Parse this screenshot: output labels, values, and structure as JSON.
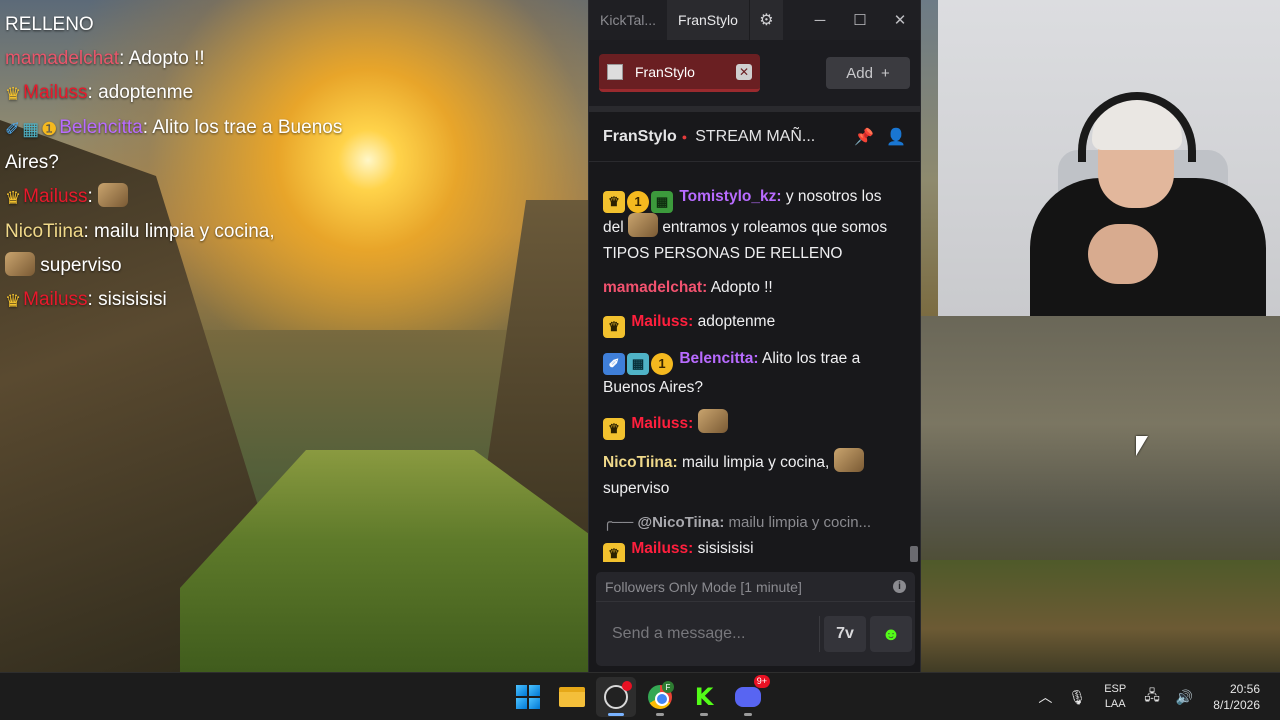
{
  "overlay_chat": {
    "l0": "RELLENO",
    "l1_user": "mamadelchat",
    "l1_text": ": Adopto !!",
    "l2_user": "Mailuss",
    "l2_text": ": adoptenme",
    "l3_user": "Belencitta",
    "l3_text": ": Alito los trae a Buenos Aires?",
    "l4_user": "Mailuss",
    "l4_text": ":",
    "l5_user": "NicoTiina",
    "l5_text": ": mailu limpia y cocina,",
    "l5_text2": "superviso",
    "l6_user": "Mailuss",
    "l6_text": ": sisisisisi",
    "colors": {
      "mamadelchat": "#e8566b",
      "mailuss": "#e8192c",
      "belencitta": "#b86bff",
      "nicotiina": "#f0d98a"
    }
  },
  "window": {
    "tab_inactive": "KickTal...",
    "tab_active": "FranStylo",
    "gear_icon": "gear-icon",
    "minimize": "─",
    "maximize": "☐",
    "close": "✕"
  },
  "tabs": {
    "channel": "FranStylo",
    "close": "✕",
    "add_label": "Add",
    "add_plus": "+"
  },
  "channel_bar": {
    "name": "FranStylo",
    "title": "STREAM MAÑ..."
  },
  "messages": [
    {
      "user": "Tomistylo_kz:",
      "color": "#b86bff",
      "text": "y nosotros los del",
      "text2": "entramos y roleamos que somos TIPOS PERSONAS DE RELLENO"
    },
    {
      "user": "mamadelchat:",
      "color": "#f2526f",
      "text": "Adopto !!"
    },
    {
      "user": "Mailuss:",
      "color": "#ff1f3d",
      "text": "adoptenme"
    },
    {
      "user": "Belencitta:",
      "color": "#b86bff",
      "text": "Alito los trae a Buenos Aires?"
    },
    {
      "user": "Mailuss:",
      "color": "#ff1f3d",
      "text": ""
    },
    {
      "user": "NicoTiina:",
      "color": "#f0d98a",
      "text": "mailu limpia y cocina,",
      "text2": "superviso"
    },
    {
      "reply_user": "@NicoTiina:",
      "reply_text": "mailu limpia y cocin..."
    },
    {
      "user": "Mailuss:",
      "color": "#ff1f3d",
      "text": "sisisisisi"
    }
  ],
  "composer": {
    "mode": "Followers Only Mode [1 minute]",
    "info": "i",
    "placeholder": "Send a message..."
  },
  "taskbar": {
    "badge_count": "9+",
    "profile_letter": "F",
    "lang_1": "ESP",
    "lang_2": "LAA",
    "time": "20:56",
    "date": "8/1/2026"
  }
}
